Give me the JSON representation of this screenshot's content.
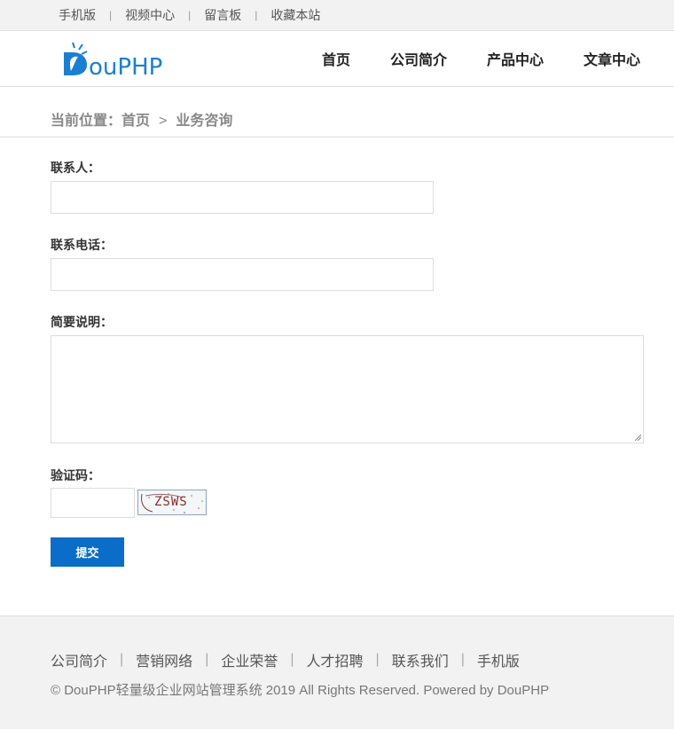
{
  "topbar": {
    "links": [
      "手机版",
      "视频中心",
      "留言板",
      "收藏本站"
    ],
    "separator": "|"
  },
  "brand": {
    "logo_text": "DouPHP",
    "accent_color": "#1a7fd0"
  },
  "nav": {
    "items": [
      "首页",
      "公司简介",
      "产品中心",
      "文章中心"
    ]
  },
  "breadcrumb": {
    "prefix": "当前位置：",
    "home": "首页",
    "arrow": ">",
    "current": "业务咨询"
  },
  "form": {
    "contact_label": "联系人：",
    "contact_value": "",
    "phone_label": "联系电话：",
    "phone_value": "",
    "description_label": "简要说明：",
    "description_value": "",
    "captcha_label": "验证码：",
    "captcha_value": "",
    "captcha_image_text": "ZSWS",
    "submit_label": "提交"
  },
  "footer": {
    "links": [
      "公司简介",
      "营销网络",
      "企业荣誉",
      "人才招聘",
      "联系我们",
      "手机版"
    ],
    "separator": "|",
    "copyright": "© DouPHP轻量级企业网站管理系统 2019 All Rights Reserved. Powered by DouPHP"
  }
}
